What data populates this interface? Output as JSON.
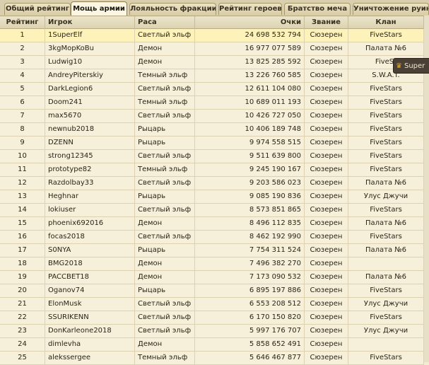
{
  "tabs": [
    {
      "label": "Общий рейтинг",
      "active": false
    },
    {
      "label": "Мощь армии",
      "active": true
    },
    {
      "label": "Лояльность фракции",
      "active": false
    },
    {
      "label": "Рейтинг героев",
      "active": false
    },
    {
      "label": "Братство меча",
      "active": false
    },
    {
      "label": "Уничтожение руин",
      "active": false
    }
  ],
  "columns": {
    "rank": "Рейтинг",
    "player": "Игрок",
    "race": "Раса",
    "score": "Очки",
    "title": "Звание",
    "clan": "Клан"
  },
  "selected_row": 1,
  "rows": [
    {
      "rank": "1",
      "player": "1SuperElf",
      "race": "Светлый эльф",
      "score": "24 698 532 794",
      "title": "Сюзерен",
      "clan": "FiveStars"
    },
    {
      "rank": "2",
      "player": "3kgMopKoBu",
      "race": "Демон",
      "score": "16 977 077 589",
      "title": "Сюзерен",
      "clan": "Палата №6"
    },
    {
      "rank": "3",
      "player": "Ludwig10",
      "race": "Демон",
      "score": "13 825 285 592",
      "title": "Сюзерен",
      "clan": "FiveSt"
    },
    {
      "rank": "4",
      "player": "AndreyPiterskiy",
      "race": "Темный эльф",
      "score": "13 226 760 585",
      "title": "Сюзерен",
      "clan": "S.W.A.T."
    },
    {
      "rank": "5",
      "player": "DarkLegion6",
      "race": "Светлый эльф",
      "score": "12 611 104 080",
      "title": "Сюзерен",
      "clan": "FiveStars"
    },
    {
      "rank": "6",
      "player": "Doom241",
      "race": "Темный эльф",
      "score": "10 689 011 193",
      "title": "Сюзерен",
      "clan": "FiveStars"
    },
    {
      "rank": "7",
      "player": "max5670",
      "race": "Светлый эльф",
      "score": "10 426 727 050",
      "title": "Сюзерен",
      "clan": "FiveStars"
    },
    {
      "rank": "8",
      "player": "newnub2018",
      "race": "Рыцарь",
      "score": "10 406 189 748",
      "title": "Сюзерен",
      "clan": "FiveStars"
    },
    {
      "rank": "9",
      "player": "DZENN",
      "race": "Рыцарь",
      "score": "9 974 558 515",
      "title": "Сюзерен",
      "clan": "FiveStars"
    },
    {
      "rank": "10",
      "player": "strong12345",
      "race": "Светлый эльф",
      "score": "9 511 639 800",
      "title": "Сюзерен",
      "clan": "FiveStars"
    },
    {
      "rank": "11",
      "player": "prototype82",
      "race": "Темный эльф",
      "score": "9 245 190 167",
      "title": "Сюзерен",
      "clan": "FiveStars"
    },
    {
      "rank": "12",
      "player": "Razdolbay33",
      "race": "Светлый эльф",
      "score": "9 203 586 023",
      "title": "Сюзерен",
      "clan": "Палата №6"
    },
    {
      "rank": "13",
      "player": "Heghnar",
      "race": "Рыцарь",
      "score": "9 085 190 836",
      "title": "Сюзерен",
      "clan": "Улус Джучи"
    },
    {
      "rank": "14",
      "player": "lokiuser",
      "race": "Светлый эльф",
      "score": "8 573 851 865",
      "title": "Сюзерен",
      "clan": "FiveStars"
    },
    {
      "rank": "15",
      "player": "phoenix692016",
      "race": "Демон",
      "score": "8 496 112 835",
      "title": "Сюзерен",
      "clan": "Палата №6"
    },
    {
      "rank": "16",
      "player": "focas2018",
      "race": "Светлый эльф",
      "score": "8 462 192 990",
      "title": "Сюзерен",
      "clan": "FiveStars"
    },
    {
      "rank": "17",
      "player": "S0NYA",
      "race": "Рыцарь",
      "score": "7 754 311 524",
      "title": "Сюзерен",
      "clan": "Палата №6"
    },
    {
      "rank": "18",
      "player": "BMG2018",
      "race": "Демон",
      "score": "7 496 382 270",
      "title": "Сюзерен",
      "clan": ""
    },
    {
      "rank": "19",
      "player": "PACCBET18",
      "race": "Демон",
      "score": "7 173 090 532",
      "title": "Сюзерен",
      "clan": "Палата №6"
    },
    {
      "rank": "20",
      "player": "Oganov74",
      "race": "Рыцарь",
      "score": "6 895 197 886",
      "title": "Сюзерен",
      "clan": "FiveStars"
    },
    {
      "rank": "21",
      "player": "ElonMusk",
      "race": "Светлый эльф",
      "score": "6 553 208 512",
      "title": "Сюзерен",
      "clan": "Улус Джучи"
    },
    {
      "rank": "22",
      "player": "SSURIKENN",
      "race": "Светлый эльф",
      "score": "6 170 150 820",
      "title": "Сюзерен",
      "clan": "FiveStars"
    },
    {
      "rank": "23",
      "player": "DonKarleone2018",
      "race": "Светлый эльф",
      "score": "5 997 176 707",
      "title": "Сюзерен",
      "clan": "Улус Джучи"
    },
    {
      "rank": "24",
      "player": "dimlevha",
      "race": "Демон",
      "score": "5 858 652 491",
      "title": "Сюзерен",
      "clan": ""
    },
    {
      "rank": "25",
      "player": "alekssergee",
      "race": "Темный эльф",
      "score": "5 646 467 877",
      "title": "Сюзерен",
      "clan": "FiveStars"
    }
  ],
  "tooltip": {
    "icon": "crown-icon",
    "text": "Super"
  }
}
